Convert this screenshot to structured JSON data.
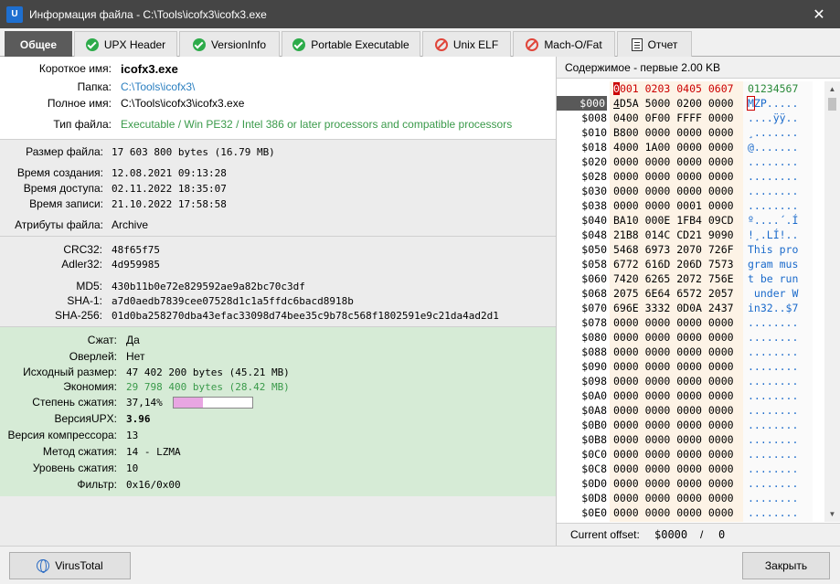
{
  "window": {
    "title": "Информация файла - C:\\Tools\\icofx3\\icofx3.exe",
    "app_icon": "U"
  },
  "tabs": [
    {
      "label": "Общее",
      "icon": "none",
      "active": true
    },
    {
      "label": "UPX Header",
      "icon": "check-icon"
    },
    {
      "label": "VersionInfo",
      "icon": "check-icon"
    },
    {
      "label": "Portable Executable",
      "icon": "check-icon"
    },
    {
      "label": "Unix ELF",
      "icon": "forbidden-icon"
    },
    {
      "label": "Mach-O/Fat",
      "icon": "forbidden-icon"
    },
    {
      "label": "Отчет",
      "icon": "report-icon"
    }
  ],
  "general": {
    "short_name_label": "Короткое имя:",
    "short_name": "icofx3.exe",
    "folder_label": "Папка:",
    "folder": "C:\\Tools\\icofx3\\",
    "full_name_label": "Полное имя:",
    "full_name": "C:\\Tools\\icofx3\\icofx3.exe",
    "file_type_label": "Тип файла:",
    "file_type": "Executable / Win PE32 / Intel 386 or later processors and compatible processors"
  },
  "times": {
    "size_label": "Размер файла:",
    "size": "17 603 800 bytes  (16.79 MB)",
    "created_label": "Время создания:",
    "created": "12.08.2021 09:13:28",
    "accessed_label": "Время доступа:",
    "accessed": "02.11.2022 18:35:07",
    "written_label": "Время записи:",
    "written": "21.10.2022 17:58:58",
    "attrs_label": "Атрибуты файла:",
    "attrs": "Archive"
  },
  "hashes": {
    "crc32_label": "CRC32:",
    "crc32": "48f65f75",
    "adler32_label": "Adler32:",
    "adler32": "4d959985",
    "md5_label": "MD5:",
    "md5": "430b11b0e72e829592ae9a82bc70c3df",
    "sha1_label": "SHA-1:",
    "sha1": "a7d0aedb7839cee07528d1c1a5ffdc6bacd8918b",
    "sha256_label": "SHA-256:",
    "sha256": "01d0ba258270dba43efac33098d74bee35c9b78c568f1802591e9c21da4ad2d1"
  },
  "upx": {
    "packed_label": "Сжат:",
    "packed": "Да",
    "overlay_label": "Оверлей:",
    "overlay": "Нет",
    "orig_size_label": "Исходный размер:",
    "orig_size": "47 402 200 bytes  (45.21 MB)",
    "saving_label": "Экономия:",
    "saving": "29 798 400 bytes  (28.42 MB)",
    "ratio_label": "Степень сжатия:",
    "ratio": "37,14%",
    "ratio_fraction": 0.3714,
    "ratio_color": "#e8a6e2",
    "upx_version_label": "ВерсияUPX:",
    "upx_version": "3.96",
    "packer_version_label": "Версия компрессора:",
    "packer_version": "13",
    "method_label": "Метод сжатия:",
    "method": "14 - LZMA",
    "level_label": "Уровень сжатия:",
    "level": "10",
    "filter_label": "Фильтр:",
    "filter": "0x16/0x00"
  },
  "hex": {
    "header": "Содержимое - первые 2.00 KB",
    "col_bytes": "0001 0203 0405 0607",
    "col_ascii": "01234567",
    "rows": [
      {
        "addr": "$000",
        "bytes": "4D5A 5000 0200 0000",
        "ascii": "MZP....."
      },
      {
        "addr": "$008",
        "bytes": "0400 0F00 FFFF 0000",
        "ascii": "....ÿÿ.."
      },
      {
        "addr": "$010",
        "bytes": "B800 0000 0000 0000",
        "ascii": "¸......."
      },
      {
        "addr": "$018",
        "bytes": "4000 1A00 0000 0000",
        "ascii": "@......."
      },
      {
        "addr": "$020",
        "bytes": "0000 0000 0000 0000",
        "ascii": "........"
      },
      {
        "addr": "$028",
        "bytes": "0000 0000 0000 0000",
        "ascii": "........"
      },
      {
        "addr": "$030",
        "bytes": "0000 0000 0000 0000",
        "ascii": "........"
      },
      {
        "addr": "$038",
        "bytes": "0000 0000 0001 0000",
        "ascii": "........"
      },
      {
        "addr": "$040",
        "bytes": "BA10 000E 1FB4 09CD",
        "ascii": "º....´.Í"
      },
      {
        "addr": "$048",
        "bytes": "21B8 014C CD21 9090",
        "ascii": "!¸.LÍ!.."
      },
      {
        "addr": "$050",
        "bytes": "5468 6973 2070 726F",
        "ascii": "This pro"
      },
      {
        "addr": "$058",
        "bytes": "6772 616D 206D 7573",
        "ascii": "gram mus"
      },
      {
        "addr": "$060",
        "bytes": "7420 6265 2072 756E",
        "ascii": "t be run"
      },
      {
        "addr": "$068",
        "bytes": "2075 6E64 6572 2057",
        "ascii": " under W"
      },
      {
        "addr": "$070",
        "bytes": "696E 3332 0D0A 2437",
        "ascii": "in32..$7"
      },
      {
        "addr": "$078",
        "bytes": "0000 0000 0000 0000",
        "ascii": "........"
      },
      {
        "addr": "$080",
        "bytes": "0000 0000 0000 0000",
        "ascii": "........"
      },
      {
        "addr": "$088",
        "bytes": "0000 0000 0000 0000",
        "ascii": "........"
      },
      {
        "addr": "$090",
        "bytes": "0000 0000 0000 0000",
        "ascii": "........"
      },
      {
        "addr": "$098",
        "bytes": "0000 0000 0000 0000",
        "ascii": "........"
      },
      {
        "addr": "$0A0",
        "bytes": "0000 0000 0000 0000",
        "ascii": "........"
      },
      {
        "addr": "$0A8",
        "bytes": "0000 0000 0000 0000",
        "ascii": "........"
      },
      {
        "addr": "$0B0",
        "bytes": "0000 0000 0000 0000",
        "ascii": "........"
      },
      {
        "addr": "$0B8",
        "bytes": "0000 0000 0000 0000",
        "ascii": "........"
      },
      {
        "addr": "$0C0",
        "bytes": "0000 0000 0000 0000",
        "ascii": "........"
      },
      {
        "addr": "$0C8",
        "bytes": "0000 0000 0000 0000",
        "ascii": "........"
      },
      {
        "addr": "$0D0",
        "bytes": "0000 0000 0000 0000",
        "ascii": "........"
      },
      {
        "addr": "$0D8",
        "bytes": "0000 0000 0000 0000",
        "ascii": "........"
      },
      {
        "addr": "$0E0",
        "bytes": "0000 0000 0000 0000",
        "ascii": "........"
      }
    ],
    "offset_label": "Current offset:",
    "offset_value": "$0000",
    "offset_sep": "/",
    "offset_dec": "0"
  },
  "buttons": {
    "virustotal": "VirusTotal",
    "close": "Закрыть"
  },
  "colors": {
    "accent_green": "#2dab4a",
    "forbidden_red": "#e0453a",
    "link_blue": "#2a7fc0"
  }
}
